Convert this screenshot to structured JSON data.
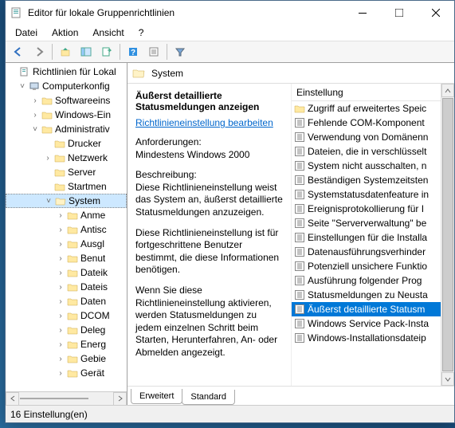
{
  "window": {
    "title": "Editor für lokale Gruppenrichtlinien"
  },
  "menubar": {
    "items": [
      "Datei",
      "Aktion",
      "Ansicht",
      "?"
    ]
  },
  "tree": {
    "root": "Richtlinien für Lokal",
    "computer_config": "Computerkonfig",
    "nodes": {
      "software": "Softwareeins",
      "windows": "Windows-Ein",
      "admin": "Administrativ",
      "drucker": "Drucker",
      "netzwerk": "Netzwerk",
      "server": "Server",
      "startmen": "Startmen",
      "system": "System",
      "sub": [
        "Anme",
        "Antisc",
        "Ausgl",
        "Benut",
        "Dateik",
        "Dateis",
        "Daten",
        "DCOM",
        "Deleg",
        "Energ",
        "Gebie",
        "Gerät"
      ]
    }
  },
  "path": {
    "current": "System"
  },
  "detail": {
    "title": "Äußerst detaillierte Statusmeldungen anzeigen",
    "edit_link": "Richtlinieneinstellung bearbeiten",
    "req_label": "Anforderungen:",
    "req_text": "Mindestens Windows 2000",
    "desc_label": "Beschreibung:",
    "desc_p1": "Diese Richtlinieneinstellung weist das System an, äußerst detaillierte Statusmeldungen anzuzeigen.",
    "desc_p2": "Diese Richtlinieneinstellung ist für fortgeschrittene Benutzer bestimmt, die diese Informationen benötigen.",
    "desc_p3": "Wenn Sie diese Richtlinieneinstellung aktivieren, werden Statusmeldungen zu jedem einzelnen Schritt beim Starten, Herunterfahren, An- oder Abmelden angezeigt."
  },
  "list": {
    "header": "Einstellung",
    "items": [
      {
        "label": "Zugriff auf erweitertes Speic",
        "type": "folder"
      },
      {
        "label": "Fehlende COM-Komponent",
        "type": "setting"
      },
      {
        "label": "Verwendung von Domänenn",
        "type": "setting"
      },
      {
        "label": "Dateien, die in verschlüsselt",
        "type": "setting"
      },
      {
        "label": "System nicht ausschalten, n",
        "type": "setting"
      },
      {
        "label": "Beständigen Systemzeitsten",
        "type": "setting"
      },
      {
        "label": "Systemstatusdatenfeature in",
        "type": "setting"
      },
      {
        "label": "Ereignisprotokollierung für I",
        "type": "setting"
      },
      {
        "label": "Seite \"Serververwaltung\" be",
        "type": "setting"
      },
      {
        "label": "Einstellungen für die Installa",
        "type": "setting"
      },
      {
        "label": "Datenausführungsverhinder",
        "type": "setting"
      },
      {
        "label": "Potenziell unsichere Funktio",
        "type": "setting"
      },
      {
        "label": "Ausführung folgender Prog",
        "type": "setting"
      },
      {
        "label": "Statusmeldungen zu Neusta",
        "type": "setting"
      },
      {
        "label": "Äußerst detaillierte Statusm",
        "type": "setting",
        "selected": true
      },
      {
        "label": "Windows Service Pack-Insta",
        "type": "setting"
      },
      {
        "label": "Windows-Installationsdateip",
        "type": "setting"
      }
    ]
  },
  "tabs": {
    "extended": "Erweitert",
    "standard": "Standard"
  },
  "statusbar": {
    "text": "16 Einstellung(en)"
  }
}
